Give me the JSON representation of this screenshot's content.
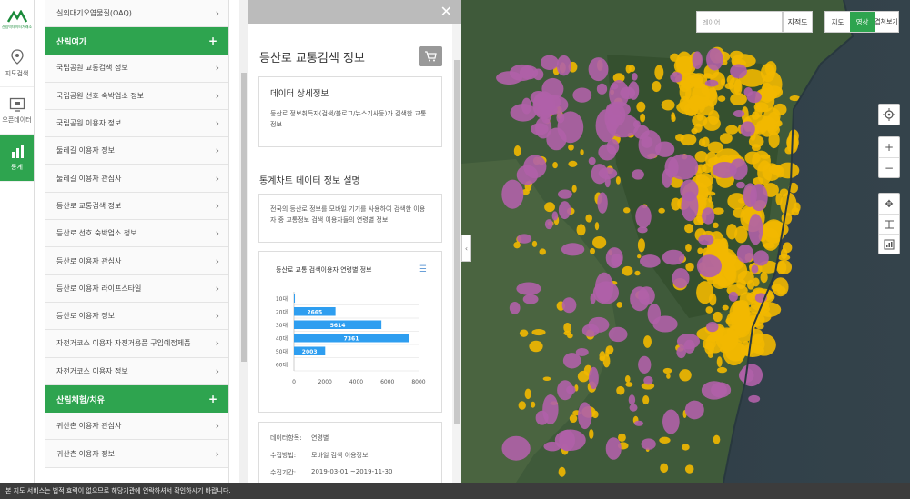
{
  "rail": {
    "logo_text": "산림빅데이터거래소",
    "items": [
      {
        "label": "지도검색",
        "icon": "map-pin-icon"
      },
      {
        "label": "오픈데이터",
        "icon": "open-data-icon"
      },
      {
        "label": "통계",
        "icon": "bar-chart-icon",
        "active": true
      }
    ]
  },
  "menu": {
    "top_item": "실외대기오염물질(OAQ)",
    "category1": "산림여가",
    "items1": [
      "국립공원 교통검색 정보",
      "국립공원 선호 숙박업소 정보",
      "국립공원 이용자 정보",
      "둘레길 이용자 정보",
      "둘레길 이용자 관심사",
      "등산로 교통검색 정보",
      "등산로 선호 숙박업소 정보",
      "등산로 이용자 관심사",
      "등산로 이용자 라이프스타일",
      "등산로 이용자 정보",
      "자전거코스 이용자 자전거용품 구입예정제품",
      "자전거코스 이용자 정보"
    ],
    "category2": "산림체험/치유",
    "items2": [
      "귀산촌 이용자 관심사",
      "귀산촌 이용자 정보"
    ]
  },
  "panel": {
    "title": "등산로 교통검색 정보",
    "detail_title": "데이터 상세정보",
    "detail_text": "등산로 정보취득자(검색/블로그/뉴스기사등)가 검색한 교통정보",
    "section_title": "통계차트 데이터 정보 설명",
    "desc_text": "전국의 등산로 정보를 모바일 기기를 사용하여 검색한 이용자 중 교통정보 검색 이용자들의 연령별 정보",
    "meta": [
      {
        "key": "데이터항목:",
        "value": "연령별"
      },
      {
        "key": "수집방법:",
        "value": "모바일 검색 이용정보"
      },
      {
        "key": "수집기간:",
        "value": "2019-03-01 ~2019-11-30"
      }
    ]
  },
  "map": {
    "search_placeholder": "레이어",
    "search_button": "지적도",
    "types": [
      "지도",
      "영상",
      "겹쳐보기"
    ],
    "active_type": "영상"
  },
  "footer": {
    "notice": "본 지도 서비스는 법적 효력이 없으므로 해당기관에 연락하셔서 확인하시기 바랍니다."
  },
  "chart_data": {
    "type": "bar",
    "orientation": "horizontal",
    "title": "등산로 교통 검색이용자 연령별 정보",
    "categories": [
      "10대",
      "20대",
      "30대",
      "40대",
      "50대",
      "60대"
    ],
    "values": [
      60,
      2665,
      5614,
      7361,
      2003,
      0
    ],
    "data_labels": [
      "",
      "2665",
      "5614",
      "7361",
      "2003",
      ""
    ],
    "xlim": [
      0,
      8000
    ],
    "xticks": [
      "0",
      "2000",
      "4000",
      "6000",
      "8000"
    ],
    "color": "#2e9ef0"
  },
  "colors": {
    "accent": "#2ea44f",
    "bar": "#2e9ef0",
    "map_yellow": "#f2b800",
    "map_purple": "#b060a8"
  }
}
